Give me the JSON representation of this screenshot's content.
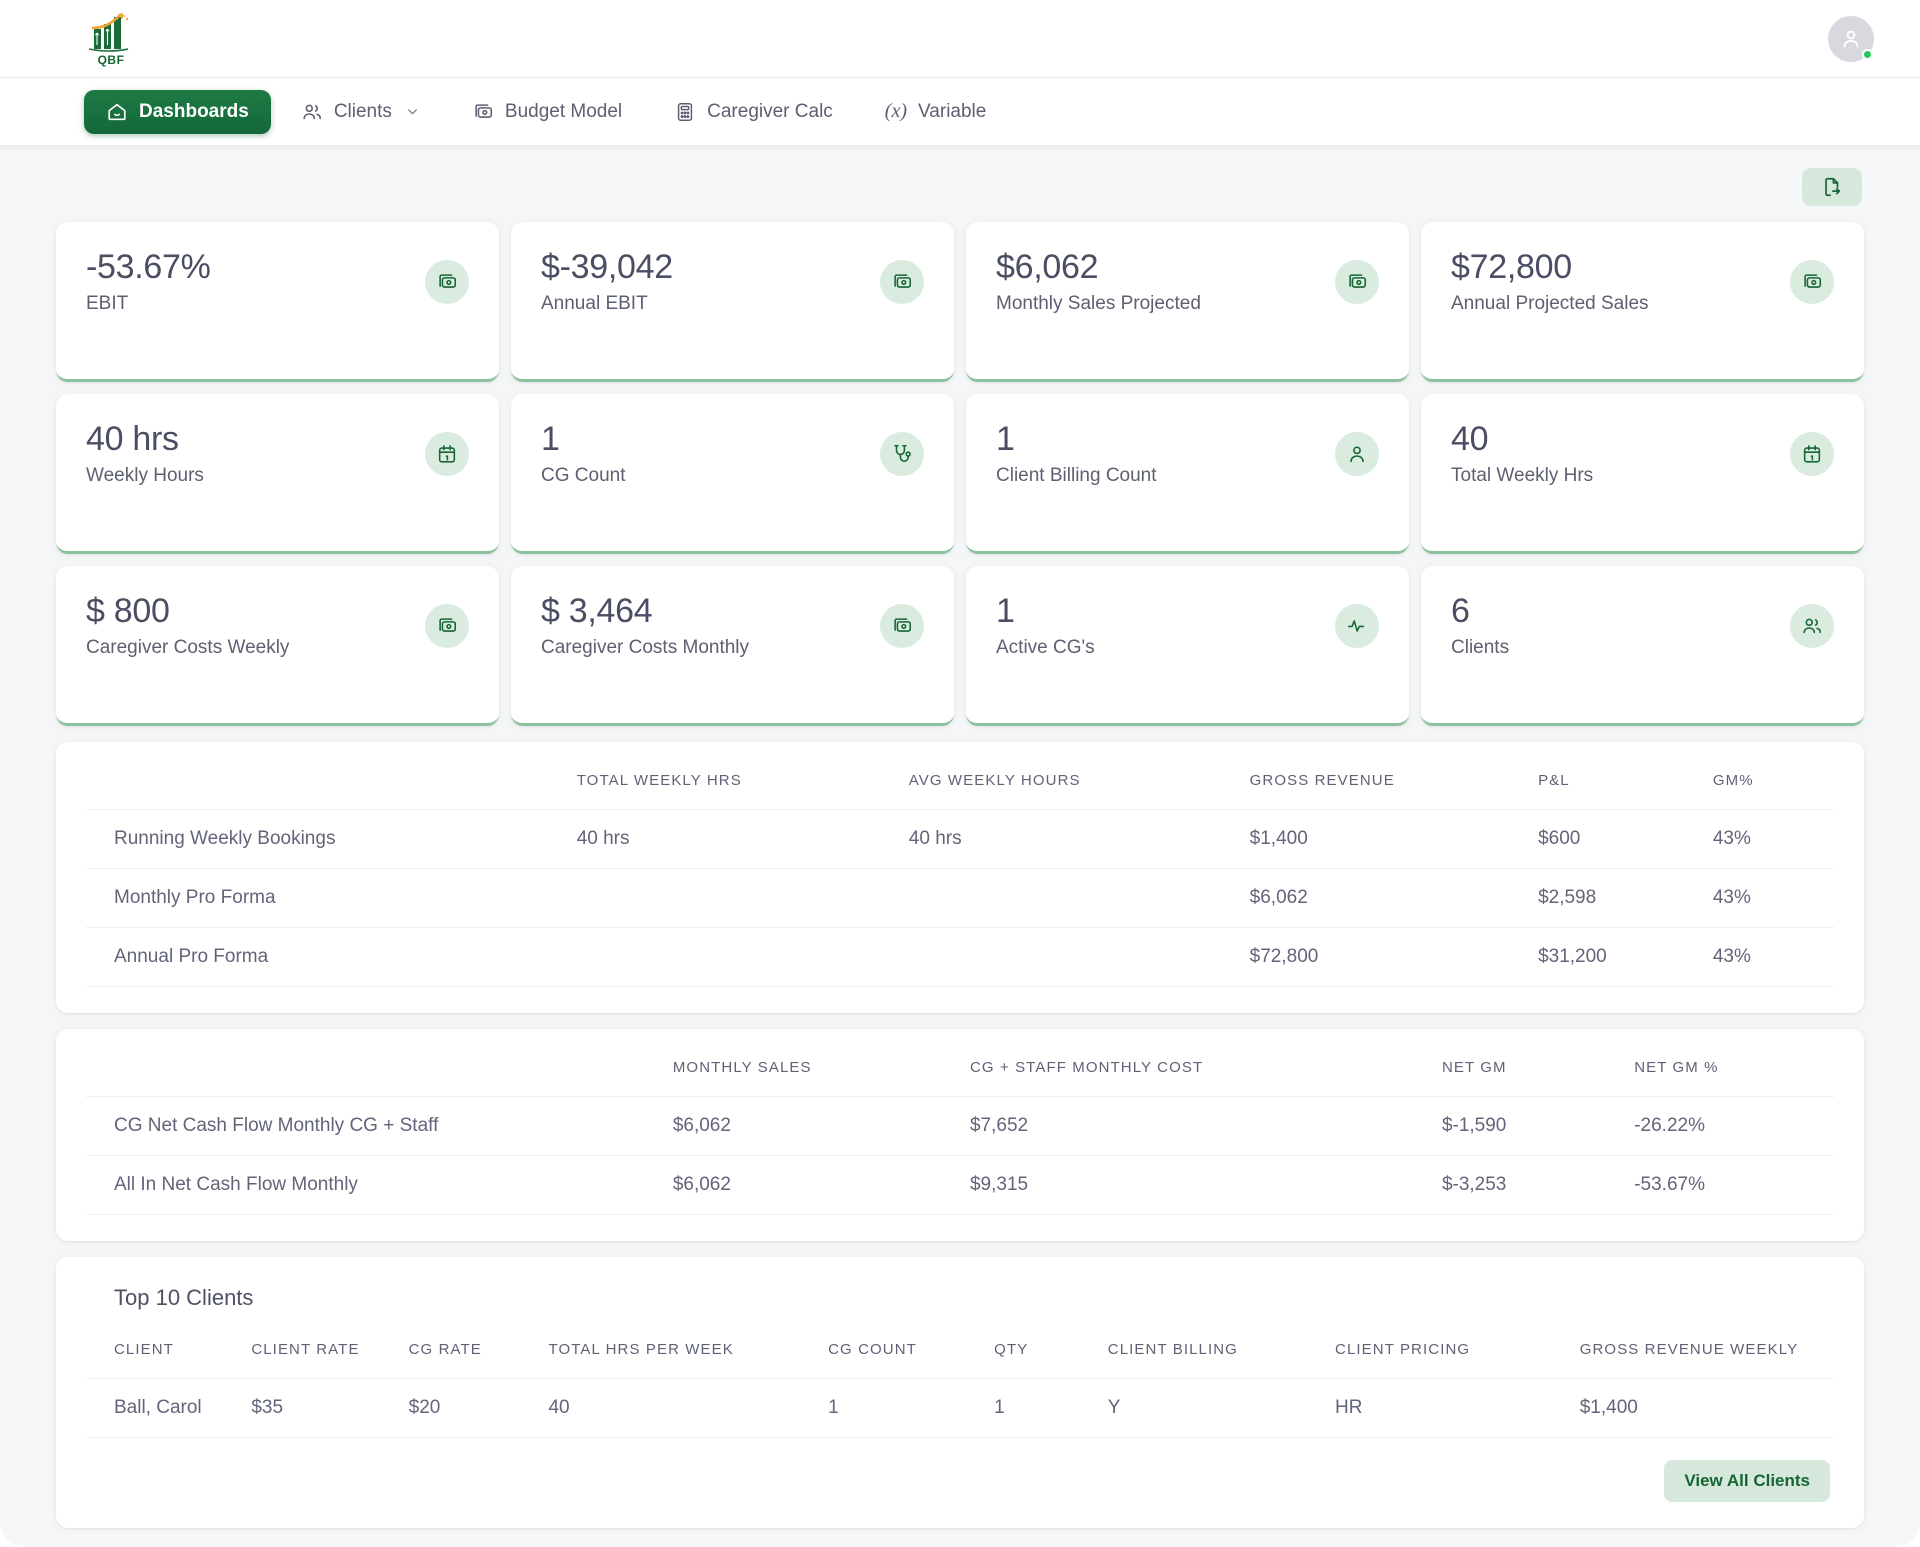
{
  "brand": {
    "logo_text": "QBF"
  },
  "nav": {
    "items": [
      {
        "label": "Dashboards",
        "icon": "home-icon",
        "active": true,
        "chevron": false
      },
      {
        "label": "Clients",
        "icon": "users-icon",
        "active": false,
        "chevron": true
      },
      {
        "label": "Budget Model",
        "icon": "money-icon",
        "active": false,
        "chevron": false
      },
      {
        "label": "Caregiver Calc",
        "icon": "calculator-icon",
        "active": false,
        "chevron": false
      },
      {
        "label": "Variable",
        "icon": "fx-icon",
        "active": false,
        "chevron": false
      }
    ]
  },
  "toolbar": {
    "export_icon": "file-export-icon"
  },
  "kpis": [
    {
      "value": "-53.67%",
      "label": "EBIT",
      "icon": "money-icon"
    },
    {
      "value": "$-39,042",
      "label": "Annual EBIT",
      "icon": "money-icon"
    },
    {
      "value": "$6,062",
      "label": "Monthly Sales Projected",
      "icon": "money-icon"
    },
    {
      "value": "$72,800",
      "label": "Annual Projected Sales",
      "icon": "money-icon"
    },
    {
      "value": "40 hrs",
      "label": "Weekly Hours",
      "icon": "calendar-icon"
    },
    {
      "value": "1",
      "label": "CG Count",
      "icon": "stethoscope-icon"
    },
    {
      "value": "1",
      "label": "Client Billing Count",
      "icon": "user-icon"
    },
    {
      "value": "40",
      "label": "Total Weekly Hrs",
      "icon": "calendar-icon"
    },
    {
      "value": "$ 800",
      "label": "Caregiver Costs Weekly",
      "icon": "money-icon"
    },
    {
      "value": "$ 3,464",
      "label": "Caregiver Costs Monthly",
      "icon": "money-icon"
    },
    {
      "value": "1",
      "label": "Active CG's",
      "icon": "activity-icon"
    },
    {
      "value": "6",
      "label": "Clients",
      "icon": "users-icon"
    }
  ],
  "pro_forma_table": {
    "columns": [
      "",
      "TOTAL WEEKLY HRS",
      "AVG WEEKLY HOURS",
      "GROSS REVENUE",
      "P&L",
      "GM%"
    ],
    "rows": [
      [
        "Running Weekly Bookings",
        "40 hrs",
        "40 hrs",
        "$1,400",
        "$600",
        "43%"
      ],
      [
        "Monthly Pro Forma",
        "",
        "",
        "$6,062",
        "$2,598",
        "43%"
      ],
      [
        "Annual Pro Forma",
        "",
        "",
        "$72,800",
        "$31,200",
        "43%"
      ]
    ]
  },
  "cash_flow_table": {
    "columns": [
      "",
      "MONTHLY SALES",
      "CG + STAFF MONTHLY COST",
      "NET GM",
      "NET GM %"
    ],
    "rows": [
      [
        "CG Net Cash Flow Monthly CG + Staff",
        "$6,062",
        "$7,652",
        "$-1,590",
        "-26.22%"
      ],
      [
        "All In Net Cash Flow Monthly",
        "$6,062",
        "$9,315",
        "$-3,253",
        "-53.67%"
      ]
    ]
  },
  "clients_panel": {
    "title": "Top 10 Clients",
    "columns": [
      "CLIENT",
      "CLIENT RATE",
      "CG RATE",
      "TOTAL HRS PER WEEK",
      "CG COUNT",
      "QTY",
      "CLIENT BILLING",
      "CLIENT PRICING",
      "GROSS REVENUE WEEKLY"
    ],
    "rows": [
      [
        "Ball, Carol",
        "$35",
        "$20",
        "40",
        "1",
        "1",
        "Y",
        "HR",
        "$1,400"
      ]
    ],
    "view_all_label": "View All Clients"
  },
  "colors": {
    "brand_green": "#166534",
    "nav_active": "#14683a",
    "icon_bg": "#d9ecdf",
    "card_border": "#8cc39d",
    "page_bg": "#f5f6f8",
    "text": "#5d6071"
  }
}
